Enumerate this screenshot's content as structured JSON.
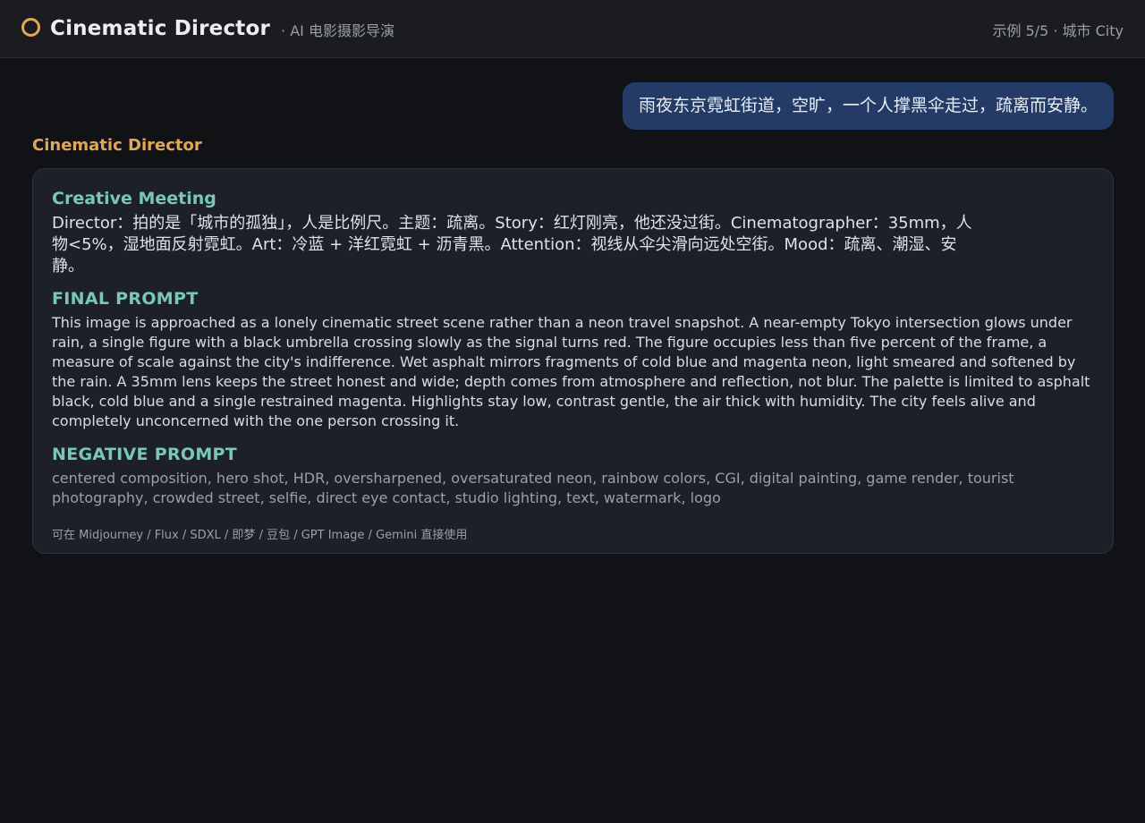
{
  "header": {
    "title": "Cinematic Director",
    "subtitle": "· AI 电影摄影导演",
    "example_indicator": "示例 5/5 · 城市 City"
  },
  "user_message": "雨夜东京霓虹街道，空旷，一个人撑黑伞走过，疏离而安静。",
  "assistant": {
    "name": "Cinematic Director",
    "meeting": {
      "title": "Creative Meeting",
      "text": "Director：拍的是「城市的孤独」，人是比例尺。主题：疏离。Story：红灯刚亮，他还没过街。Cinematographer：35mm，人物<5%，湿地面反射霓虹。Art：冷蓝 + 洋红霓虹 + 沥青黑。Attention：视线从伞尖滑向远处空街。Mood：疏离、潮湿、安静。"
    },
    "final_prompt": {
      "title": "FINAL PROMPT",
      "text": "This image is approached as a lonely cinematic street scene rather than a neon travel snapshot. A near-empty Tokyo intersection glows under rain, a single figure with a black umbrella crossing slowly as the signal turns red. The figure occupies less than five percent of the frame, a measure of scale against the city's indifference. Wet asphalt mirrors fragments of cold blue and magenta neon, light smeared and softened by the rain. A 35mm lens keeps the street honest and wide; depth comes from atmosphere and reflection, not blur. The palette is limited to asphalt black, cold blue and a single restrained magenta. Highlights stay low, contrast gentle, the air thick with humidity. The city feels alive and completely unconcerned with the one person crossing it."
    },
    "negative_prompt": {
      "title": "NEGATIVE PROMPT",
      "text": "centered composition, hero shot, HDR, oversharpened, oversaturated neon, rainbow colors, CGI, digital painting, game render, tourist photography, crowded street, selfie, direct eye contact, studio lighting, text, watermark, logo"
    },
    "footnote": "可在 Midjourney / Flux / SDXL / 即梦 / 豆包 / GPT Image / Gemini 直接使用"
  },
  "colors": {
    "accent": "#e3a75a",
    "section_title": "#79c8b3",
    "user_bubble": "#233b66",
    "background": "#111216"
  }
}
